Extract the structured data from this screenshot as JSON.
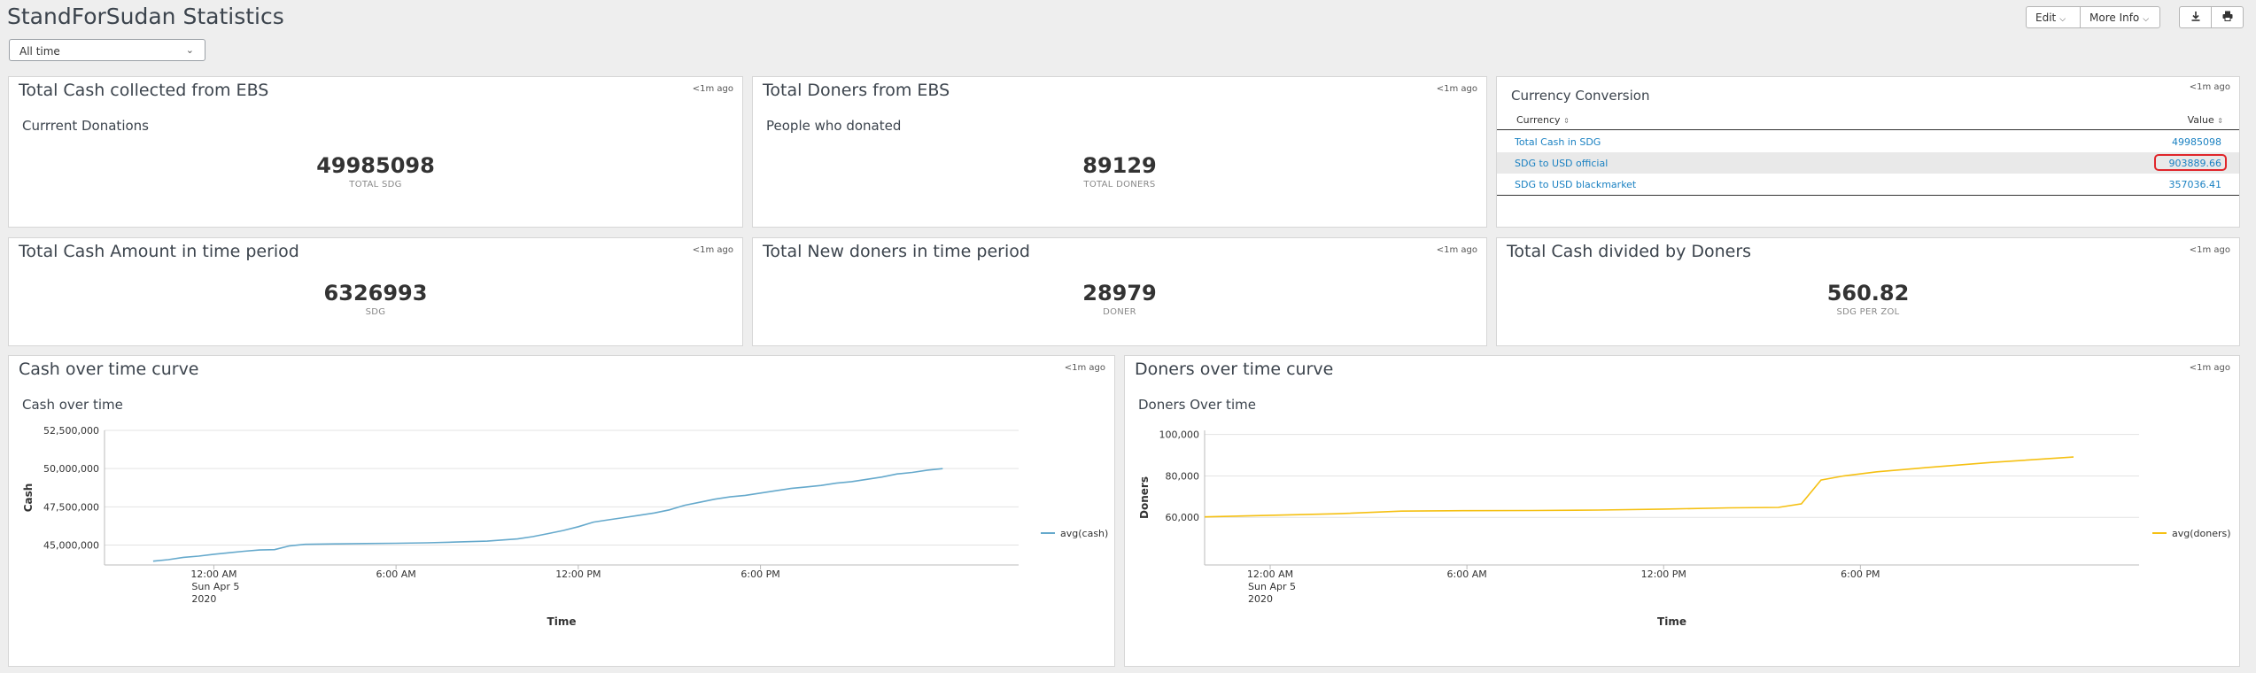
{
  "page": {
    "title": "StandForSudan Statistics",
    "time_range": "All time",
    "buttons": {
      "edit": "Edit",
      "more_info": "More Info"
    }
  },
  "panels": {
    "total_cash": {
      "title": "Total Cash collected from EBS",
      "ago": "<1m ago",
      "subtitle": "Currrent Donations",
      "value": "49985098",
      "unit": "TOTAL SDG"
    },
    "total_doners": {
      "title": "Total Doners from EBS",
      "ago": "<1m ago",
      "subtitle": "People who donated",
      "value": "89129",
      "unit": "TOTAL DONERS"
    },
    "currency": {
      "title": "Currency Conversion",
      "ago": "<1m ago",
      "col_currency": "Currency",
      "col_value": "Value",
      "rows": [
        {
          "name": "Total Cash in SDG",
          "value": "49985098"
        },
        {
          "name": "SDG to USD official",
          "value": "903889.66"
        },
        {
          "name": "SDG to USD blackmarket",
          "value": "357036.41"
        }
      ]
    },
    "cash_period": {
      "title": "Total Cash Amount in time period",
      "ago": "<1m ago",
      "value": "6326993",
      "unit": "SDG"
    },
    "new_doners": {
      "title": "Total New doners in time period",
      "ago": "<1m ago",
      "value": "28979",
      "unit": "DONER"
    },
    "cash_per_doner": {
      "title": "Total Cash divided by Doners",
      "ago": "<1m ago",
      "value": "560.82",
      "unit": "SDG PER ZOL"
    },
    "cash_curve": {
      "title": "Cash over time curve",
      "ago": "<1m ago",
      "subtitle": "Cash over time"
    },
    "doners_curve": {
      "title": "Doners over time curve",
      "ago": "<1m ago",
      "subtitle": "Doners Over time"
    }
  },
  "chart_data": [
    {
      "type": "line",
      "title": "Cash over time",
      "xlabel": "Time",
      "ylabel": "Cash",
      "x_tick_labels": [
        "12:00 AM",
        "6:00 AM",
        "12:00 PM",
        "6:00 PM"
      ],
      "x_tick_date": [
        "Sun Apr 5",
        "2020"
      ],
      "y_tick_labels": [
        "45,000,000",
        "47,500,000",
        "50,000,000",
        "52,500,000"
      ],
      "ylim": [
        43700000,
        52500000
      ],
      "legend": "right",
      "color": "#65a9cc",
      "series": [
        {
          "name": "avg(cash)",
          "x": [
            -2,
            -1.5,
            -1,
            -0.5,
            0,
            0.5,
            1,
            1.5,
            2,
            2.5,
            3,
            4,
            5,
            6,
            7,
            8,
            9,
            9.5,
            10,
            10.5,
            11,
            11.5,
            12,
            12.5,
            13,
            13.5,
            14,
            14.5,
            15,
            15.5,
            16,
            16.5,
            17,
            17.5,
            18,
            18.5,
            19,
            19.5,
            20,
            20.5,
            21,
            21.5,
            22,
            22.5,
            23,
            23.5,
            24
          ],
          "values": [
            43950000,
            44050000,
            44200000,
            44280000,
            44400000,
            44500000,
            44600000,
            44680000,
            44700000,
            44950000,
            45050000,
            45080000,
            45100000,
            45120000,
            45150000,
            45200000,
            45260000,
            45330000,
            45400000,
            45550000,
            45750000,
            45950000,
            46200000,
            46500000,
            46650000,
            46800000,
            46950000,
            47100000,
            47300000,
            47600000,
            47800000,
            48000000,
            48150000,
            48250000,
            48400000,
            48550000,
            48700000,
            48800000,
            48900000,
            49050000,
            49150000,
            49300000,
            49450000,
            49650000,
            49750000,
            49900000,
            50000000
          ]
        }
      ]
    },
    {
      "type": "line",
      "title": "Doners Over time",
      "xlabel": "Time",
      "ylabel": "Doners",
      "x_tick_labels": [
        "12:00 AM",
        "6:00 AM",
        "12:00 PM",
        "6:00 PM"
      ],
      "x_tick_date": [
        "Sun Apr 5",
        "2020"
      ],
      "y_tick_labels": [
        "60,000",
        "80,000",
        "100,000"
      ],
      "ylim": [
        37000,
        102000
      ],
      "legend": "right",
      "color": "#f5c012",
      "series": [
        {
          "name": "avg(doners)",
          "x": [
            -2,
            0,
            2,
            4,
            6,
            8,
            10,
            12,
            14,
            15.5,
            16.2,
            16.8,
            17.5,
            18.5,
            20,
            22,
            24.5
          ],
          "values": [
            60200,
            61000,
            61700,
            63000,
            63200,
            63300,
            63500,
            64000,
            64600,
            64800,
            66500,
            78000,
            80000,
            82000,
            84000,
            86500,
            89129
          ]
        }
      ]
    }
  ]
}
